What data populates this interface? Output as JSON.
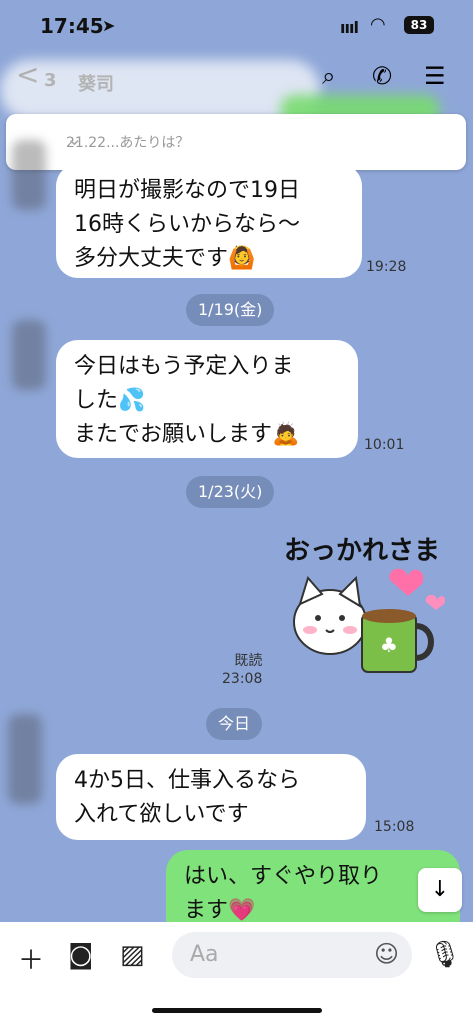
{
  "status": {
    "time": "17:45",
    "signal": "ıııl",
    "wifi": "⟟",
    "battery": "83"
  },
  "header": {
    "back": "<",
    "unread_count": "3",
    "name": "葵司"
  },
  "pinned": {
    "text": "21.22...あたりは？"
  },
  "messages": [
    {
      "text": "明日が撮影なので19日\n16時くらいからなら〜\n多分大丈夫です🙆",
      "time": "19:28"
    },
    {
      "text": "今日はもう予定入りま\nした💦\nまたでお願いします🙇",
      "time": "10:01"
    },
    {
      "text": "4か5日、仕事入るなら\n入れて欲しいです",
      "time": "15:08"
    },
    {
      "text": "はい、すぐやり取り\nます💗"
    }
  ],
  "dates": {
    "d1": "1/19(金)",
    "d2": "1/23(火)",
    "d3": "今日"
  },
  "sticker": {
    "text": "おっかれさま",
    "read": "既読",
    "time": "23:08"
  },
  "input": {
    "placeholder": "Aa"
  }
}
